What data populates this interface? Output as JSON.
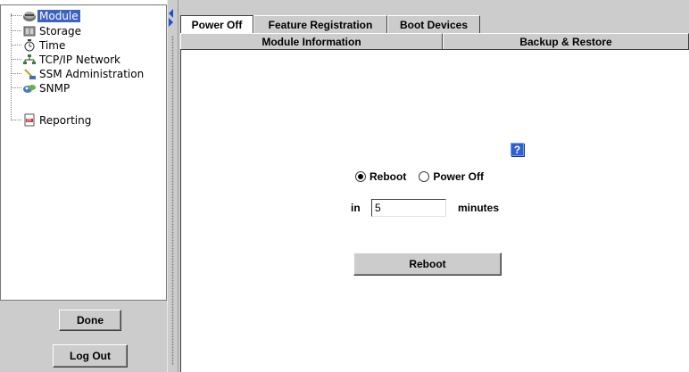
{
  "tree": {
    "items": [
      {
        "label": "Module",
        "icon": "module-icon",
        "selected": true
      },
      {
        "label": "Storage",
        "icon": "storage-icon"
      },
      {
        "label": "Time",
        "icon": "time-icon"
      },
      {
        "label": "TCP/IP Network",
        "icon": "network-icon"
      },
      {
        "label": "SSM Administration",
        "icon": "admin-icon"
      },
      {
        "label": "SNMP",
        "icon": "snmp-icon"
      },
      {
        "label": "Reporting",
        "icon": "reporting-icon"
      }
    ],
    "selection_color": "#3d62c0"
  },
  "buttons": {
    "done": "Done",
    "logout": "Log Out"
  },
  "tabs": {
    "top": [
      "Power Off",
      "Feature Registration",
      "Boot Devices"
    ],
    "bottom": [
      "Module Information",
      "Backup & Restore"
    ],
    "active": "Power Off"
  },
  "form": {
    "help_symbol": "?",
    "radio_options": [
      {
        "label": "Reboot",
        "checked": true
      },
      {
        "label": "Power Off",
        "checked": false
      }
    ],
    "in_label": "in",
    "minutes_value": "5",
    "minutes_label": "minutes",
    "submit_label": "Reboot"
  },
  "colors": {
    "panel_gray": "#cccccc",
    "help_blue": "#2f5fd0"
  }
}
